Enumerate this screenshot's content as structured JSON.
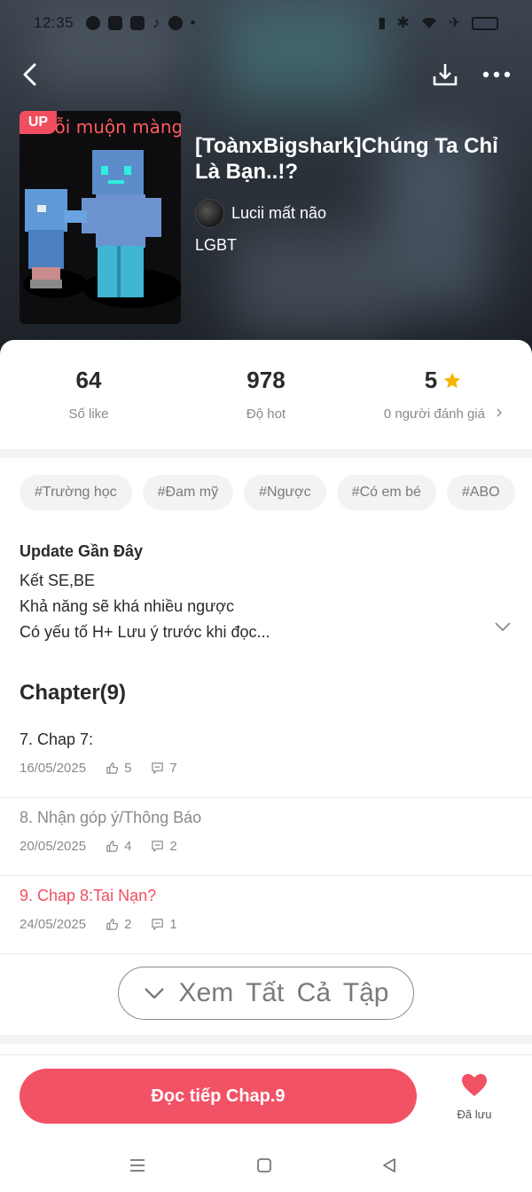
{
  "status_bar": {
    "time": "12:35"
  },
  "book": {
    "title": "[ToànxBigshark]Chúng Ta Chỉ Là Bạn..!?",
    "author": "Lucii mất não",
    "genre": "LGBT",
    "badge": "UP",
    "cover_text": "lỗi muộn màng"
  },
  "stats": [
    {
      "value": "64",
      "label": "Số like"
    },
    {
      "value": "978",
      "label": "Độ hot"
    },
    {
      "value": "5",
      "label": "0 người đánh giá"
    }
  ],
  "tags": [
    "#Trường học",
    "#Đam mỹ",
    "#Ngược",
    "#Có em bé",
    "#ABO"
  ],
  "update": {
    "title": "Update Gần Đây",
    "lines": [
      "Kết SE,BE",
      "Khả năng sẽ khá nhiều ngược",
      "Có yếu tố H+ Lưu ý trước khi đọc..."
    ]
  },
  "chapters_title": "Chapter(9)",
  "chapters": [
    {
      "title": "7. Chap 7:",
      "date": "16/05/2025",
      "likes": "5",
      "comments": "7",
      "state": "normal"
    },
    {
      "title": "8. Nhận góp ý/Thông Báo",
      "date": "20/05/2025",
      "likes": "4",
      "comments": "2",
      "state": "read"
    },
    {
      "title": "9. Chap 8:Tai Nạn?",
      "date": "24/05/2025",
      "likes": "2",
      "comments": "1",
      "state": "current"
    }
  ],
  "see_all_label": "Xem Tất Cả Tập",
  "read_button_label": "Đọc tiếp Chap.9",
  "saved_label": "Đã lưu",
  "colors": {
    "accent": "#f25266",
    "current_chapter": "#f04e5e",
    "star": "#f5b400"
  },
  "icons": [
    "back-icon",
    "download-icon",
    "more-icon",
    "star-icon",
    "chevron-right-icon",
    "chevron-down-icon",
    "thumbs-up-icon",
    "comment-icon",
    "heart-icon",
    "menu-icon",
    "home-square-icon",
    "back-triangle-icon"
  ]
}
